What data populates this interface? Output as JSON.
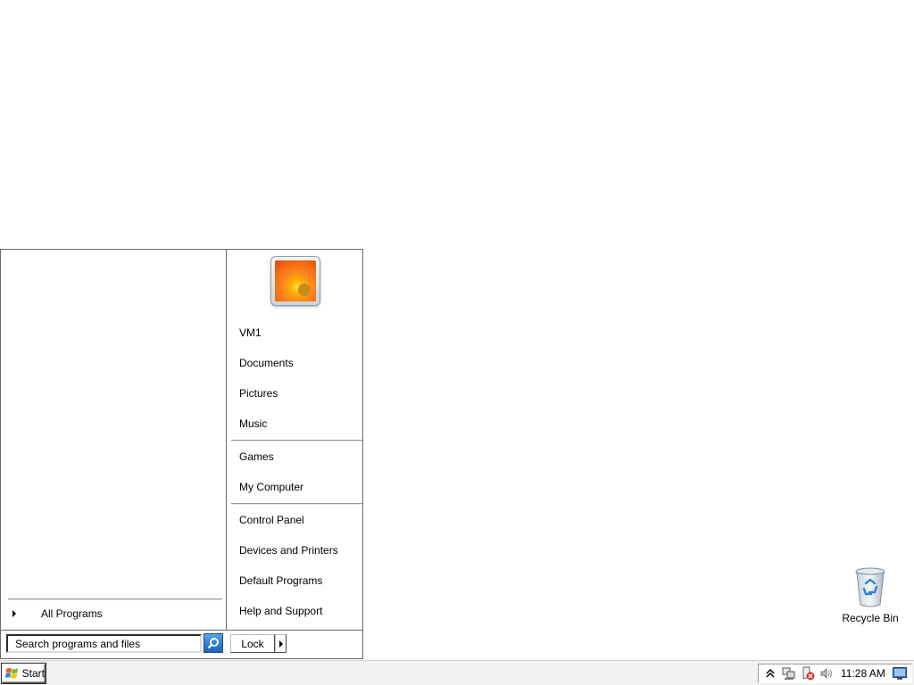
{
  "start_menu": {
    "all_programs_label": "All Programs",
    "right_items": {
      "user": "VM1",
      "documents": "Documents",
      "pictures": "Pictures",
      "music": "Music",
      "games": "Games",
      "computer": "My Computer",
      "control_panel": "Control Panel",
      "devices": "Devices and Printers",
      "default_programs": "Default Programs",
      "help": "Help and Support"
    },
    "search": {
      "placeholder": "Search programs and files",
      "value": "Search programs and files"
    },
    "lock_label": "Lock"
  },
  "desktop": {
    "icons": [
      {
        "label": "Recycle Bin",
        "icon": "recycle-bin-icon"
      }
    ]
  },
  "taskbar": {
    "start_label": "Start",
    "clock": "11:28 AM",
    "tray_icons": [
      "show-hidden-icons-icon",
      "network-icon",
      "action-center-icon",
      "volume-icon",
      "show-desktop-icon"
    ]
  }
}
